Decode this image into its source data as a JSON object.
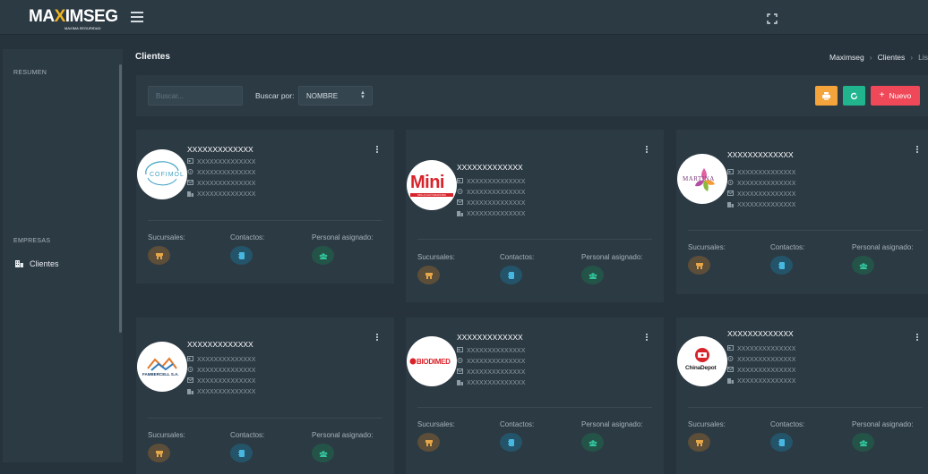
{
  "header": {
    "logo": {
      "part1": "MA",
      "x": "X",
      "part2": "IMSEG",
      "tagline": "MAXIMA SEGURIDAD"
    },
    "colors": {
      "accent": "#f3b51f"
    }
  },
  "sidebar": {
    "section_summary": "RESUMEN",
    "section_companies": "EMPRESAS",
    "items": [
      {
        "label": "Clientes",
        "icon": "building-icon"
      }
    ]
  },
  "page": {
    "title": "Clientes",
    "breadcrumb": [
      "Maximseg",
      "Clientes",
      "Lis"
    ]
  },
  "toolbar": {
    "search_placeholder": "Buscar...",
    "search_by_label": "Buscar por:",
    "search_by_value": "NOMBRE",
    "new_label": "Nuevo",
    "colors": {
      "print": "#f5a33b",
      "refresh": "#21b58e",
      "new": "#ef4859"
    }
  },
  "card_labels": {
    "sucursales": "Sucursales:",
    "contactos": "Contactos:",
    "personal": "Personal asignado:"
  },
  "clients": [
    {
      "name": "XXXXXXXXXXXXX",
      "logo_text": "COFIMOL",
      "info": [
        "XXXXXXXXXXXXXX",
        "XXXXXXXXXXXXXX",
        "XXXXXXXXXXXXXX",
        "XXXXXXXXXXXXXX"
      ]
    },
    {
      "name": "XXXXXXXXXXXXX",
      "logo_text": "Mini",
      "logo_sub": "SPA & FACTURADORA",
      "info": [
        "XXXXXXXXXXXXXX",
        "XXXXXXXXXXXXXX",
        "XXXXXXXXXXXXXX",
        "XXXXXXXXXXXXXX"
      ]
    },
    {
      "name": "XXXXXXXXXXXXX",
      "logo_text": "MARTINA",
      "info": [
        "XXXXXXXXXXXXXX",
        "XXXXXXXXXXXXXX",
        "XXXXXXXXXXXXXX",
        "XXXXXXXXXXXXXX"
      ]
    },
    {
      "name": "XXXXXXXXXXXXX",
      "logo_text": "FAMBERCELL S.A.",
      "info": [
        "XXXXXXXXXXXXXX",
        "XXXXXXXXXXXXXX",
        "XXXXXXXXXXXXXX",
        "XXXXXXXXXXXXXX"
      ]
    },
    {
      "name": "XXXXXXXXXXXXX",
      "logo_text": "BIODIMED",
      "info": [
        "XXXXXXXXXXXXXX",
        "XXXXXXXXXXXXXX",
        "XXXXXXXXXXXXXX",
        "XXXXXXXXXXXXXX"
      ]
    },
    {
      "name": "XXXXXXXXXXXXX",
      "logo_text": "ChinaDepot",
      "info": [
        "XXXXXXXXXXXXXX",
        "XXXXXXXXXXXXXX",
        "XXXXXXXXXXXXXX",
        "XXXXXXXXXXXXXX"
      ]
    }
  ]
}
